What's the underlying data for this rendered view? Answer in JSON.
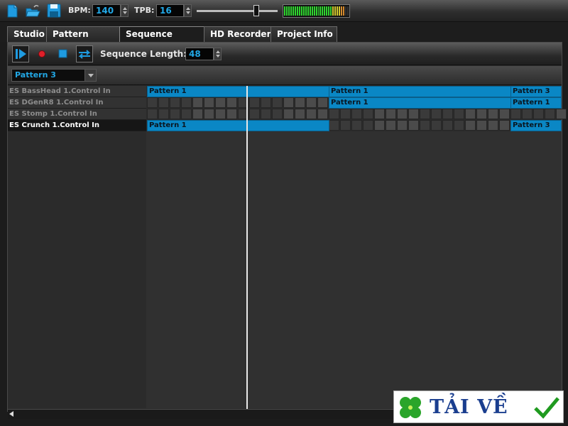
{
  "toolbar": {
    "icons": [
      "new-file-icon",
      "open-folder-icon",
      "save-disk-icon"
    ],
    "bpm_label": "BPM:",
    "bpm_value": "140",
    "tpb_label": "TPB:",
    "tpb_value": "16"
  },
  "tabs": [
    {
      "label": "Studio",
      "active": false
    },
    {
      "label": "Pattern Editor",
      "active": false
    },
    {
      "label": "Sequence Editor",
      "active": true
    },
    {
      "label": "HD Recorder",
      "active": false
    },
    {
      "label": "Project Info",
      "active": false
    }
  ],
  "transport": {
    "buttons": [
      "play-icon",
      "record-icon",
      "stop-icon",
      "loop-icon"
    ],
    "sequence_length_label": "Sequence Length:",
    "sequence_length_value": "48"
  },
  "pattern_selector": {
    "selected": "Pattern 3"
  },
  "tracks": [
    {
      "name": "ES BassHead 1.Control In",
      "active": false,
      "blocks": [
        {
          "label": "Pattern 1"
        },
        {
          "label": "Pattern 1"
        },
        {
          "label": "Pattern 3"
        }
      ]
    },
    {
      "name": "ES DGenR8 1.Control In",
      "active": false,
      "blocks": [
        {
          "label": "Pattern 1"
        },
        {
          "label": "Pattern 1"
        }
      ]
    },
    {
      "name": "ES Stomp 1.Control In",
      "active": false,
      "blocks": []
    },
    {
      "name": "ES Crunch 1.Control In",
      "active": true,
      "blocks": [
        {
          "label": "Pattern 1"
        },
        {
          "label": "Pattern 3"
        }
      ]
    }
  ],
  "colors": {
    "pattern_block": "#0a87c5",
    "value_text": "#22a8e6",
    "meter_green": "#2fd42f"
  },
  "watermark": {
    "text": "TẢI VỀ"
  }
}
